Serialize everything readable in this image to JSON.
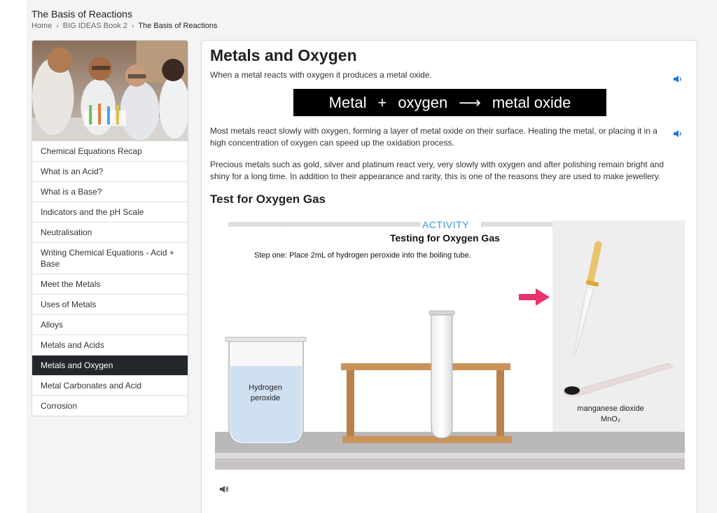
{
  "header": {
    "title": "The Basis of Reactions",
    "breadcrumb": [
      "Home",
      "BIG IDEAS Book 2",
      "The Basis of Reactions"
    ]
  },
  "sidebar": {
    "items": [
      "Chemical Equations Recap",
      "What is an Acid?",
      "What is a Base?",
      "Indicators and the pH Scale",
      "Neutralisation",
      "Writing Chemical Equations - Acid + Base",
      "Meet the Metals",
      "Uses of Metals",
      "Alloys",
      "Metals and Acids",
      "Metals and Oxygen",
      "Metal Carbonates and Acid",
      "Corrosion"
    ],
    "active_index": 10
  },
  "main": {
    "title": "Metals and Oxygen",
    "intro": "When a metal reacts with oxygen it produces a metal oxide.",
    "equation": {
      "left": "Metal",
      "plus": "+",
      "middle": "oxygen",
      "arrow": "⟶",
      "right": "metal oxide"
    },
    "para2": "Most metals react slowly with oxygen, forming a layer of metal oxide on their surface. Heating the metal, or placing it in a high concentration of oxygen can speed up the oxidation process.",
    "para3": "Precious metals such as gold, silver and platinum react very, very slowly with oxygen and after polishing remain bright and shiny for a long time. In addition to their appearance and rarity, this is one of the reasons they are used to make jewellery.",
    "subtitle": "Test for Oxygen Gas"
  },
  "activity": {
    "label": "ACTIVITY",
    "title": "Testing for Oxygen Gas",
    "step": "Step one: Place 2mL of hydrogen peroxide into the boiling tube.",
    "beaker_label_1": "Hydrogen",
    "beaker_label_2": "peroxide",
    "mn_label_1": "manganese dioxide",
    "mn_label_2": "MnO₂"
  },
  "colors": {
    "active_bg": "#23272b",
    "activity_blue": "#3a9ad9",
    "arrow_pink": "#e8336b",
    "speaker_blue": "#1a73d9"
  }
}
